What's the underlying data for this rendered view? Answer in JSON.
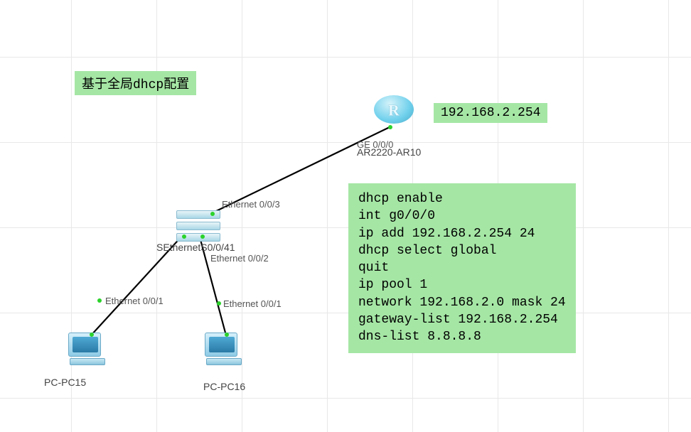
{
  "title": "基于全局dhcp配置",
  "routerIp": "192.168.2.254",
  "config": "dhcp enable\nint g0/0/0\nip add 192.168.2.254 24\ndhcp select global\nquit\nip pool 1\nnetwork 192.168.2.0 mask 24\ngateway-list 192.168.2.254\ndns-list 8.8.8.8",
  "devices": {
    "router": {
      "label": "AR2220-AR10",
      "port": "GE 0/0/0"
    },
    "switch": {
      "label": "SEthernetS0/0/41",
      "port_top": "Ethernet 0/0/3",
      "port_right": "Ethernet 0/0/2",
      "port_left": "Ethernet 0/0/1"
    },
    "pc1": {
      "label": "PC-PC15",
      "port": "Ethernet 0/0/1"
    },
    "pc2": {
      "label": "PC-PC16",
      "port": "Ethernet 0/0/1"
    }
  }
}
